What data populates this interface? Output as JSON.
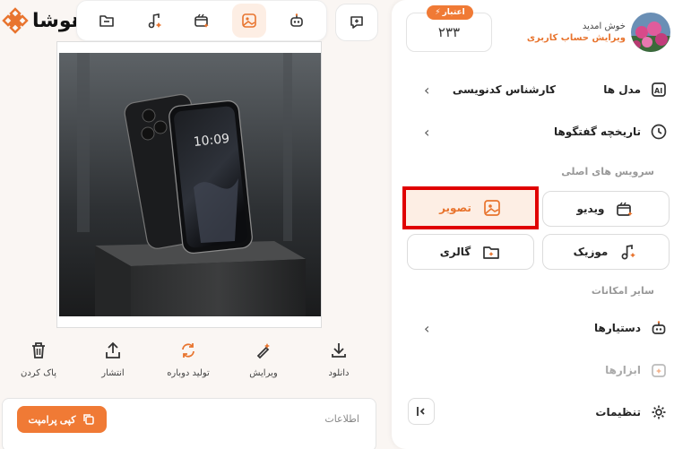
{
  "app": {
    "logo_text": "هوشا"
  },
  "topbar": {
    "items": [
      {
        "icon": "folder-icon"
      },
      {
        "icon": "music-icon"
      },
      {
        "icon": "video-icon"
      },
      {
        "icon": "image-icon",
        "active": true
      },
      {
        "icon": "robot-icon"
      }
    ],
    "chat_icon": "chat-add-icon"
  },
  "actions": {
    "download": "دانلود",
    "edit": "ویرایش",
    "regenerate": "تولید دوباره",
    "share": "انتشار",
    "delete": "پاک کردن"
  },
  "info_panel": {
    "title": "اطلاعات",
    "copy_prompt": "کپی پرامپت"
  },
  "sidebar": {
    "credit": {
      "label": "اعتبار",
      "value": "۲۳۳"
    },
    "user": {
      "welcome": "خوش امدید",
      "edit_profile": "ویرایش حساب کاربری"
    },
    "models": {
      "label": "مدل ها",
      "value": "کارشناس کدنویسی"
    },
    "history": {
      "label": "تاریخچه گفتگوها"
    },
    "main_services_title": "سرویس های اصلی",
    "services": {
      "image": "تصویر",
      "video": "ویدیو",
      "gallery": "گالری",
      "music": "موزیک"
    },
    "other_title": "سایر امکانات",
    "assistants": "دستیارها",
    "tools": "ابزارها",
    "settings": "تنظیمات"
  },
  "colors": {
    "accent": "#f07a35",
    "highlight_border": "#e00000"
  }
}
